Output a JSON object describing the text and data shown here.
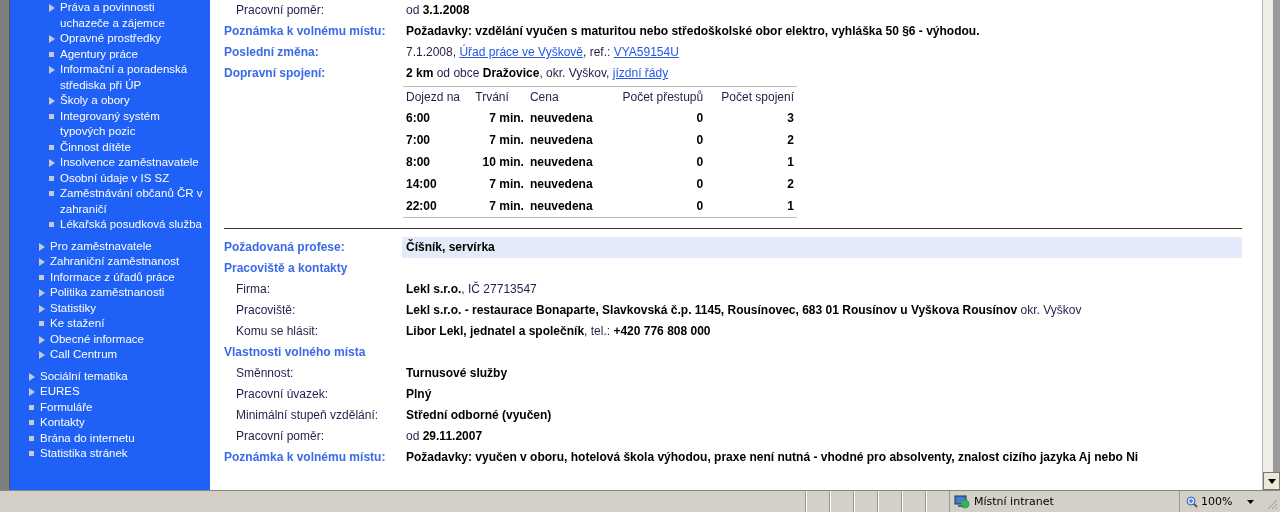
{
  "sidebar": {
    "sub_items": [
      {
        "label": "Práva a povinnosti uchazeče a zájemce",
        "kind": "arrow"
      },
      {
        "label": "Opravné prostředky",
        "kind": "arrow"
      },
      {
        "label": "Agentury práce",
        "kind": "bullet"
      },
      {
        "label": "Informační a poradenská střediska při ÚP",
        "kind": "arrow"
      },
      {
        "label": "Školy a obory",
        "kind": "arrow"
      },
      {
        "label": "Integrovaný systém typových pozic",
        "kind": "bullet"
      },
      {
        "label": "Činnost dítěte",
        "kind": "bullet"
      },
      {
        "label": "Insolvence zaměstnavatele",
        "kind": "arrow"
      },
      {
        "label": "Osobní údaje v IS SZ",
        "kind": "bullet"
      },
      {
        "label": "Zaměstnávání občanů ČR v zahraničí",
        "kind": "bullet"
      },
      {
        "label": "Lékařská posudková služba",
        "kind": "bullet"
      }
    ],
    "section_items": [
      {
        "label": "Pro zaměstnavatele",
        "kind": "arrow"
      },
      {
        "label": "Zahraniční zaměstnanost",
        "kind": "arrow"
      },
      {
        "label": "Informace z úřadů práce",
        "kind": "bullet"
      },
      {
        "label": "Politika zaměstnanosti",
        "kind": "arrow"
      },
      {
        "label": "Statistiky",
        "kind": "arrow"
      },
      {
        "label": "Ke stažení",
        "kind": "bullet"
      },
      {
        "label": "Obecné informace",
        "kind": "arrow"
      },
      {
        "label": "Call Centrum",
        "kind": "arrow"
      }
    ],
    "main_items": [
      {
        "label": "Sociální tematika",
        "kind": "arrow"
      },
      {
        "label": "EURES",
        "kind": "arrow"
      },
      {
        "label": "Formuláře",
        "kind": "bullet"
      },
      {
        "label": "Kontakty",
        "kind": "bullet"
      },
      {
        "label": "Brána do internetu",
        "kind": "bullet"
      },
      {
        "label": "Statistika stránek",
        "kind": "bullet"
      }
    ]
  },
  "listings": [
    {
      "rows": [
        {
          "kind": "field",
          "label": "Pracovní poměr:",
          "value": [
            {
              "kind": "text",
              "text": "od **3.1.2008**"
            }
          ]
        },
        {
          "kind": "note",
          "label": "Poznámka k volnému místu:",
          "value": [
            {
              "kind": "bold",
              "text": "Požadavky: vzdělání vyučen s maturitou nebo středoškolské obor elektro, vyhláška 50 §6 - výhodou."
            }
          ]
        },
        {
          "kind": "note",
          "label": "Poslední změna:",
          "value": [
            {
              "kind": "text",
              "text": "7.1.2008, "
            },
            {
              "kind": "link",
              "text": "Úřad práce ve Vyškově"
            },
            {
              "kind": "text",
              "text": ", ref.: "
            },
            {
              "kind": "link",
              "text": "VYA59154U"
            }
          ]
        },
        {
          "kind": "note",
          "label": "Dopravní spojení:",
          "value": [
            {
              "kind": "text",
              "text": "**2 km** od obce **Dražovice**, okr. Vyškov, "
            },
            {
              "kind": "link",
              "text": "jízdní řády"
            }
          ]
        },
        {
          "kind": "table",
          "columns": [
            "Dojezd na",
            "Trvání",
            "Cena",
            "Počet přestupů",
            "Počet spojení"
          ],
          "rows": [
            [
              "6:00",
              "7 min.",
              "neuvedena",
              "0",
              "3"
            ],
            [
              "7:00",
              "7 min.",
              "neuvedena",
              "0",
              "2"
            ],
            [
              "8:00",
              "10 min.",
              "neuvedena",
              "0",
              "1"
            ],
            [
              "14:00",
              "7 min.",
              "neuvedena",
              "0",
              "2"
            ],
            [
              "22:00",
              "7 min.",
              "neuvedena",
              "0",
              "1"
            ]
          ]
        }
      ]
    },
    {
      "rows": [
        {
          "kind": "highlight",
          "label": "Požadovaná profese:",
          "value": [
            {
              "kind": "bold",
              "text": "Číšník, servírka"
            }
          ]
        },
        {
          "kind": "heading",
          "label": "Pracoviště a kontakty"
        },
        {
          "kind": "field",
          "label": "Firma:",
          "value": [
            {
              "kind": "text",
              "text": "**Lekl s.r.o.**, IČ 27713547"
            }
          ]
        },
        {
          "kind": "field",
          "label": "Pracoviště:",
          "value": [
            {
              "kind": "text",
              "text": "**Lekl s.r.o. - restaurace Bonaparte, Slavkovská č.p. 1145, Rousínovec, 683 01 Rousínov u Vyškova Rousínov** okr. Vyškov"
            }
          ]
        },
        {
          "kind": "field",
          "label": "Komu se hlásit:",
          "value": [
            {
              "kind": "text",
              "text": "**Libor Lekl, jednatel a společník**, tel.: **+420 776 808 000**"
            }
          ]
        },
        {
          "kind": "heading",
          "label": "Vlastnosti volného místa"
        },
        {
          "kind": "field",
          "label": "Směnnost:",
          "value": [
            {
              "kind": "bold",
              "text": "Turnusové služby"
            }
          ]
        },
        {
          "kind": "field",
          "label": "Pracovní úvazek:",
          "value": [
            {
              "kind": "bold",
              "text": "Plný"
            }
          ]
        },
        {
          "kind": "field",
          "label": "Minimální stupeň vzdělání:",
          "value": [
            {
              "kind": "bold",
              "text": "Střední odborné (vyučen)"
            }
          ]
        },
        {
          "kind": "field",
          "label": "Pracovní poměr:",
          "value": [
            {
              "kind": "text",
              "text": "od **29.11.2007**"
            }
          ]
        },
        {
          "kind": "note",
          "label": "Poznámka k volnému místu:",
          "value": [
            {
              "kind": "bold",
              "text": "Požadavky: vyučen v oboru, hotelová škola výhodou, praxe není nutná - vhodné pro absolventy, znalost cizího jazyka Aj nebo Ni"
            }
          ]
        }
      ]
    }
  ],
  "status_bar": {
    "zone": "Místní intranet",
    "zoom": "100%"
  }
}
